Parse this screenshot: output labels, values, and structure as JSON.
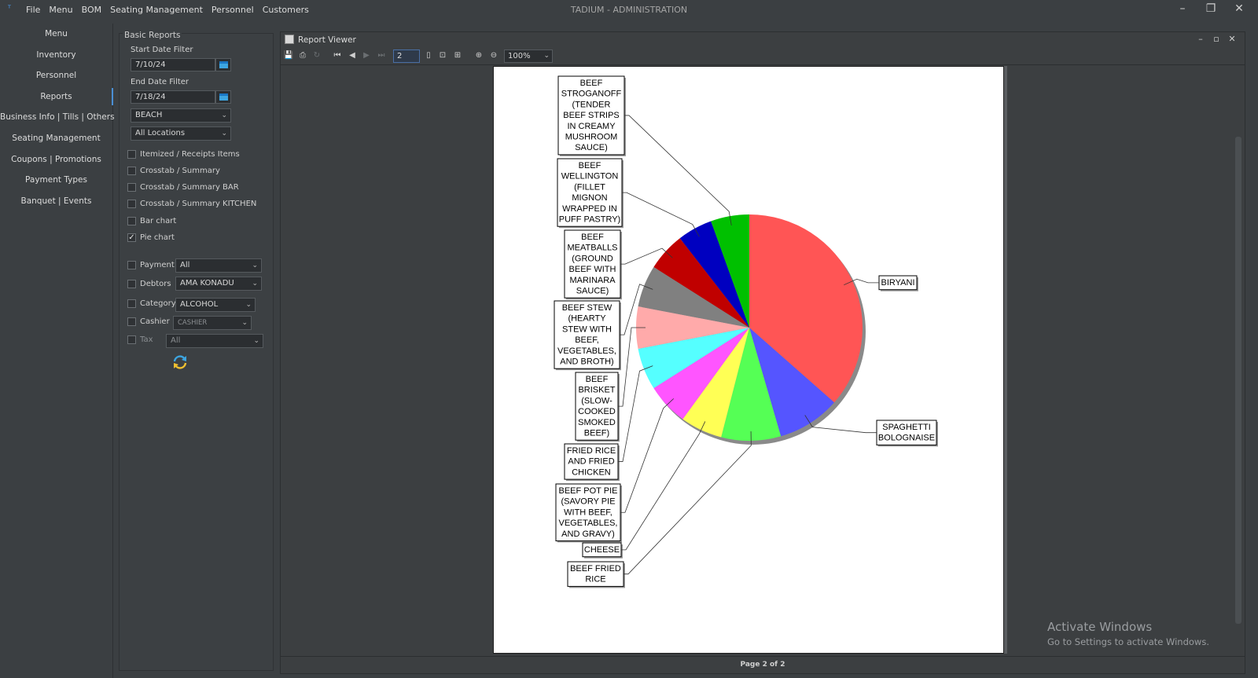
{
  "titlebar": {
    "title": "TADIUM -  ADMINISTRATION",
    "menu": [
      "File",
      "Menu",
      "BOM",
      "Seating Management",
      "Personnel",
      "Customers"
    ],
    "controls": [
      "–",
      "❐",
      "✕"
    ]
  },
  "nav": {
    "items": [
      "Menu",
      "Inventory",
      "Personnel",
      "Reports",
      "Business Info | Tills | Others",
      "Seating Management",
      "Coupons | Promotions",
      "Payment Types",
      "Banquet | Events"
    ],
    "active": "Reports"
  },
  "filters": {
    "title": "Basic Reports",
    "start_label": "Start Date Filter",
    "start_value": "7/10/24",
    "end_label": "End Date Filter",
    "end_value": "7/18/24",
    "location_dd": "BEACH",
    "locations_dd": "All Locations",
    "report_types": [
      {
        "label": "Itemized / Receipts Items",
        "checked": false
      },
      {
        "label": "Crosstab / Summary",
        "checked": false
      },
      {
        "label": "Crosstab / Summary BAR",
        "checked": false
      },
      {
        "label": "Crosstab / Summary KITCHEN",
        "checked": false
      },
      {
        "label": "Bar chart",
        "checked": false
      },
      {
        "label": "Pie chart",
        "checked": true
      }
    ],
    "payment_label": "Payment",
    "payment_value": "All",
    "debtors_label": "Debtors",
    "debtors_value": "AMA  KONADU",
    "category_label": "Category",
    "category_value": "ALCOHOL",
    "cashier_label": "Cashier",
    "cashier_value": "CASHIER",
    "tax_label": "Tax",
    "tax_value": "All"
  },
  "viewer": {
    "title": "Report Viewer",
    "page_input": "2",
    "zoom": "100%",
    "status": "Page 2 of 2"
  },
  "watermark": {
    "title": "Activate Windows",
    "subtitle": "Go to Settings to activate Windows."
  },
  "chart_data": {
    "type": "pie",
    "title": "",
    "slices": [
      {
        "label": "BIRYANI",
        "value": 36.5,
        "color": "#ff5555"
      },
      {
        "label": "SPAGHETTI BOLOGNAISE",
        "value": 9.0,
        "color": "#5555ff"
      },
      {
        "label": "BEEF FRIED RICE",
        "value": 8.5,
        "color": "#55ff55"
      },
      {
        "label": "CHEESE",
        "value": 6.0,
        "color": "#ffff55"
      },
      {
        "label": "BEEF POT PIE (SAVORY PIE WITH BEEF, VEGETABLES, AND GRAVY)",
        "value": 6.0,
        "color": "#ff55ff"
      },
      {
        "label": "FRIED RICE AND FRIED CHICKEN",
        "value": 6.0,
        "color": "#55ffff"
      },
      {
        "label": "BEEF BRISKET (SLOW-COOKED SMOKED BEEF)",
        "value": 6.0,
        "color": "#ffaaaa"
      },
      {
        "label": "BEEF STEW (HEARTY STEW WITH BEEF, VEGETABLES, AND BROTH)",
        "value": 6.0,
        "color": "#808080"
      },
      {
        "label": "BEEF MEATBALLS (GROUND BEEF WITH MARINARA SAUCE)",
        "value": 5.5,
        "color": "#c00000"
      },
      {
        "label": "BEEF WELLINGTON (FILLET MIGNON WRAPPED IN PUFF PASTRY)",
        "value": 5.0,
        "color": "#0000c0"
      },
      {
        "label": "BEEF STROGANOFF (TENDER BEEF STRIPS IN CREAMY MUSHROOM SAUCE)",
        "value": 5.5,
        "color": "#00c000"
      }
    ],
    "label_boxes": [
      {
        "lines": [
          "BEEF",
          "STROGANOFF",
          "(TENDER",
          "BEEF STRIPS",
          "IN CREAMY",
          "MUSHROOM",
          "SAUCE)"
        ]
      },
      {
        "lines": [
          "BEEF",
          "WELLINGTON",
          "(FILLET",
          "MIGNON",
          "WRAPPED IN",
          "PUFF PASTRY)"
        ]
      },
      {
        "lines": [
          "BEEF",
          "MEATBALLS",
          "(GROUND",
          "BEEF WITH",
          "MARINARA",
          "SAUCE)"
        ]
      },
      {
        "lines": [
          "BEEF STEW",
          "(HEARTY",
          "STEW WITH",
          "BEEF,",
          "VEGETABLES,",
          "AND BROTH)"
        ]
      },
      {
        "lines": [
          "BEEF",
          "BRISKET",
          "(SLOW-",
          "COOKED",
          "SMOKED",
          "BEEF)"
        ]
      },
      {
        "lines": [
          "FRIED RICE",
          "AND FRIED",
          "CHICKEN"
        ]
      },
      {
        "lines": [
          "BEEF POT PIE",
          "(SAVORY PIE",
          "WITH BEEF,",
          "VEGETABLES,",
          "AND GRAVY)"
        ]
      },
      {
        "lines": [
          "CHEESE"
        ]
      },
      {
        "lines": [
          "BEEF FRIED",
          "RICE"
        ]
      },
      {
        "lines": [
          "BIRYANI"
        ]
      },
      {
        "lines": [
          "SPAGHETTI",
          "BOLOGNAISE"
        ]
      }
    ]
  }
}
